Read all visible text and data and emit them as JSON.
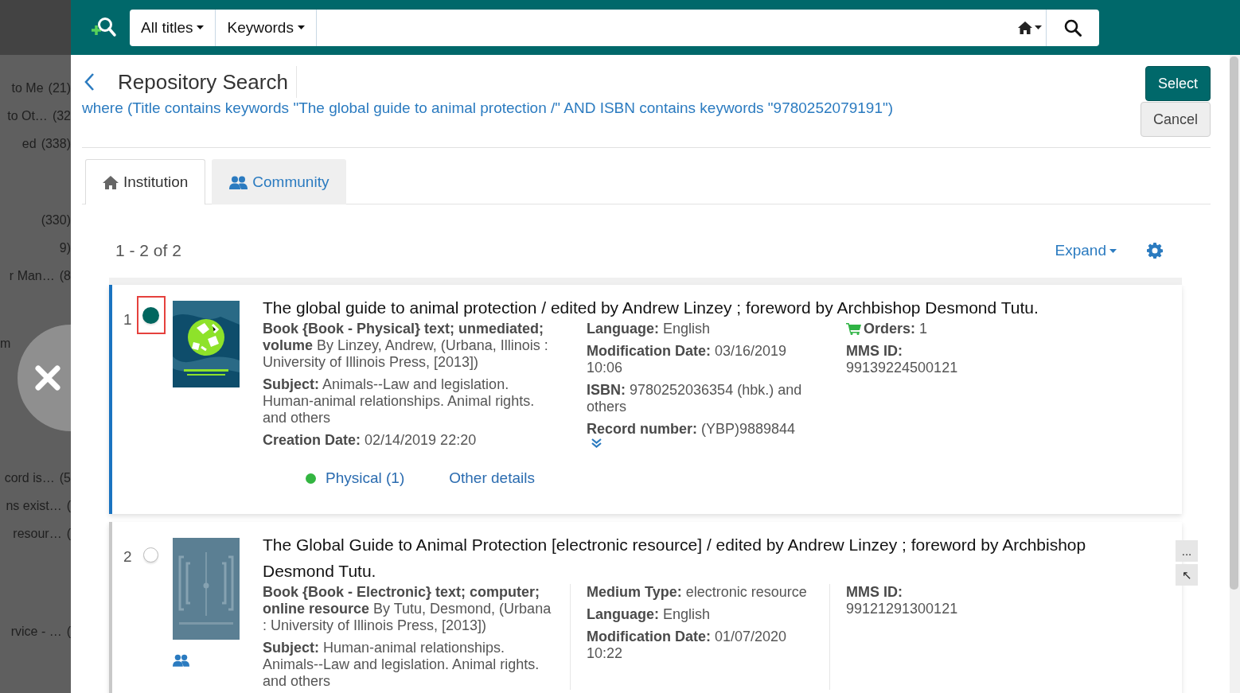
{
  "background_panel": {
    "groups": [
      [
        {
          "label": "to Me",
          "count": "(21)"
        },
        {
          "label": "to Ot…",
          "count": "(32"
        },
        {
          "label": "ed",
          "count": "(338)"
        }
      ],
      [
        {
          "count": "(330)"
        },
        {
          "count": "9)"
        },
        {
          "label": "r Man…",
          "count": "(8"
        }
      ],
      [
        {
          "label": "m"
        }
      ],
      [
        {
          "label": "cord is…",
          "count": "(5"
        },
        {
          "label": "ns exist…",
          "count": "("
        },
        {
          "label": "resour…",
          "count": "("
        }
      ],
      [
        {
          "label": "rvice - …",
          "count": "("
        }
      ]
    ]
  },
  "top_bar": {
    "scope": "All titles",
    "field": "Keywords"
  },
  "header": {
    "title": "Repository Search",
    "query": "where (Title contains keywords \"The global guide to animal protection /\" AND ISBN contains keywords \"9780252079191\")"
  },
  "buttons": [
    {
      "label": "Select",
      "kind": "primary"
    },
    {
      "label": "Cancel",
      "kind": "secondary"
    }
  ],
  "tabs": [
    {
      "label": "Institution",
      "kind": "institution",
      "selected": true
    },
    {
      "label": "Community",
      "kind": "community",
      "selected": false
    }
  ],
  "results_count": "1 - 2 of 2",
  "expand": "Expand",
  "results": [
    {
      "number": "1",
      "selected": true,
      "focused": true,
      "cover": {
        "kind": "picture"
      },
      "community": false,
      "title": "The global guide to animal protection / edited by Andrew Linzey ; foreword by Archbishop Desmond Tutu.",
      "columns": [
        [
          {
            "kind": "text",
            "text": "**Book {Book - Physical} text; unmediated; volume** By Linzey, Andrew, (Urbana, Illinois : University of Illinois Press, [2013])"
          },
          {
            "kind": "text",
            "text": "**Subject:** Animals--Law and legislation. Human-animal relationships. Animal rights. and others"
          },
          {
            "kind": "text",
            "text": "**Creation Date:** 02/14/2019 22:20"
          }
        ],
        [
          {
            "kind": "text",
            "text": "**Language:** English"
          },
          {
            "kind": "text",
            "text": "**Modification Date:** 03/16/2019 10:06"
          },
          {
            "kind": "text",
            "text": "**ISBN:** 9780252036354 (hbk.) and others"
          },
          {
            "kind": "text",
            "text": "**Record number:** (YBP)9889844"
          },
          {
            "kind": "more"
          }
        ],
        [
          {
            "kind": "orders",
            "text": "**Orders:** 1"
          },
          {
            "kind": "text",
            "text": "**MMS ID:** 99139224500121"
          }
        ]
      ],
      "links": [
        {
          "label": "Physical (1)",
          "color": "#33b541"
        },
        {
          "label": "Other details"
        }
      ]
    },
    {
      "number": "2",
      "selected": false,
      "focused": false,
      "cover": {
        "kind": "picture"
      },
      "community": true,
      "title": "The Global Guide to Animal Protection [electronic resource] / edited by Andrew Linzey ; foreword by Archbishop Desmond Tutu.",
      "columns": [
        [
          {
            "kind": "text",
            "text": "**Book {Book - Electronic} text; computer; online resource** By Tutu, Desmond, (Urbana : University of Illinois Press, [2013])"
          },
          {
            "kind": "text",
            "text": "**Subject:** Human-animal relationships. Animals--Law and legislation. Animal rights. and others"
          }
        ],
        [
          {
            "kind": "text",
            "text": "**Medium Type:** electronic resource"
          },
          {
            "kind": "text",
            "text": "**Language:** English"
          },
          {
            "kind": "text",
            "text": "**Modification Date:** 01/07/2020 10:22"
          }
        ],
        [
          {
            "kind": "text",
            "text": "**MMS ID:** 99121291300121"
          }
        ]
      ],
      "side_actions": [
        "...",
        "↖"
      ]
    }
  ]
}
